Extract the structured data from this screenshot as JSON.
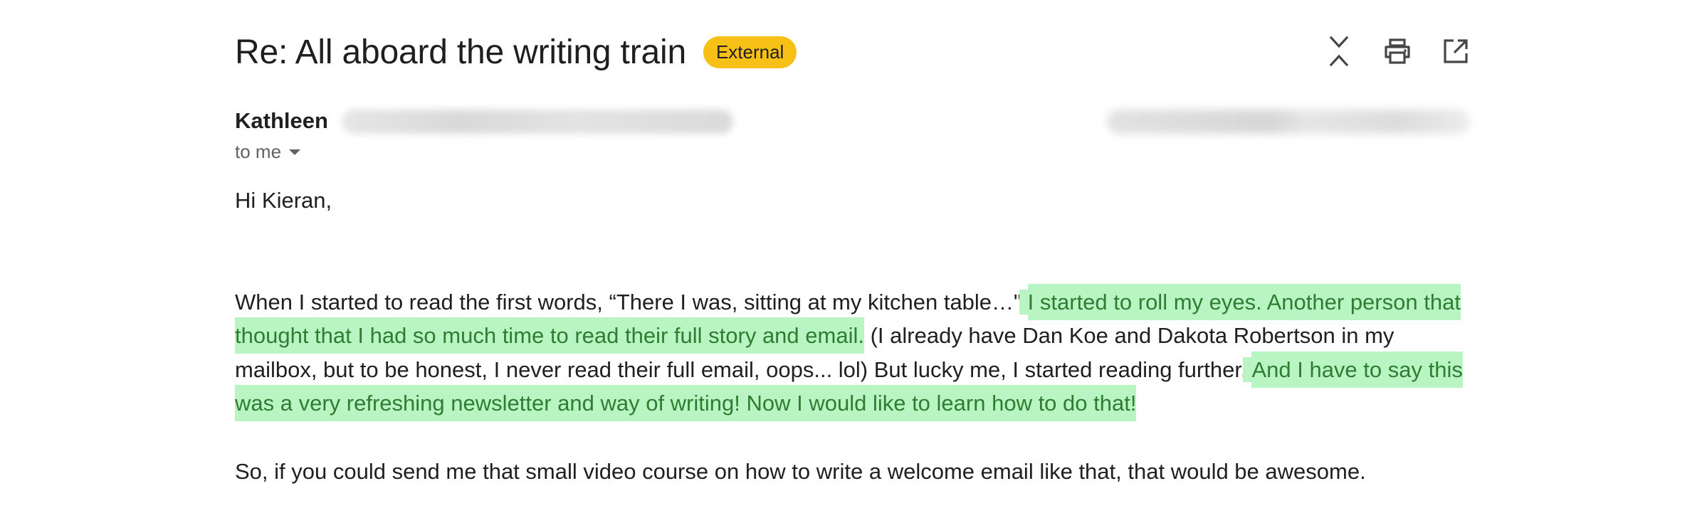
{
  "header": {
    "subject": "Re: All aboard the writing train",
    "badge": "External",
    "actions": [
      {
        "name": "collapse-all",
        "icon": "unfold-less-icon"
      },
      {
        "name": "print",
        "icon": "print-icon"
      },
      {
        "name": "open-in-new-window",
        "icon": "open-in-new-icon"
      }
    ]
  },
  "sender": {
    "name": "Kathleen",
    "recipient": "to me"
  },
  "body": {
    "greeting": "Hi Kieran,",
    "p1_part1": "When I started to read the first words, “There I was, sitting at my kitchen table…\" ",
    "p1_highlight1": "I started to roll my eyes. Another person that thought that I had so much time to read their full story and email.",
    "p1_part2": " (I already have Dan Koe and Dakota Robertson in my mailbox, but to be honest, I never read their full email, oops... lol) But lucky me, I started reading further. ",
    "p1_highlight2": "And I have to say this was a very refreshing newsletter and way of writing! Now I would like to learn how to do that!",
    "p2": "So, if you could send me that small video course on how to write a welcome email like that, that would be awesome."
  },
  "colors": {
    "badge": "#f7c016",
    "highlight_bg": "#b8f5c2",
    "highlight_text": "#2e7d32"
  }
}
